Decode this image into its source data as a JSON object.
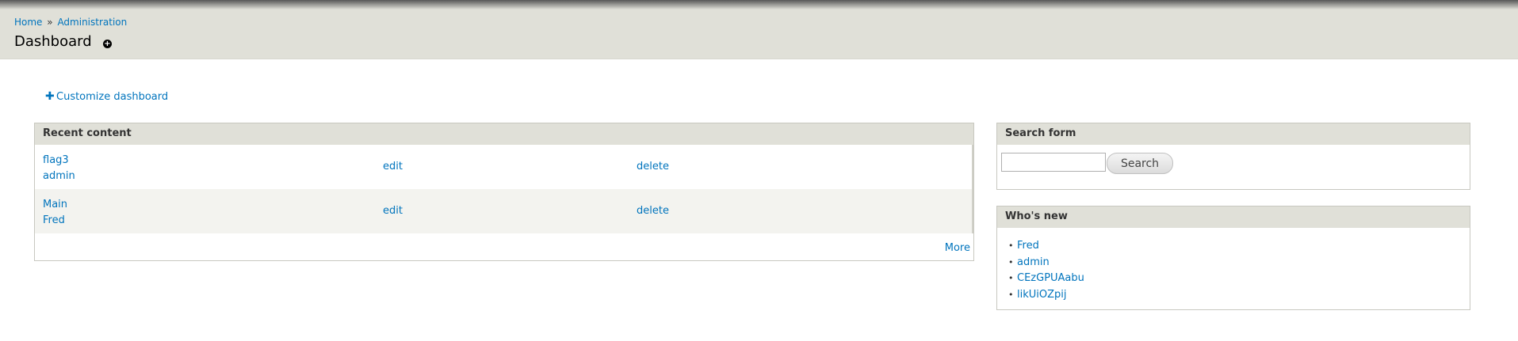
{
  "breadcrumb": {
    "items": [
      {
        "label": "Home"
      },
      {
        "label": "Administration"
      }
    ],
    "separator": "»"
  },
  "page": {
    "title": "Dashboard",
    "shortcut_icon": "add-shortcut-icon"
  },
  "customize": {
    "icon": "plus-icon",
    "label": "Customize dashboard"
  },
  "recent_content": {
    "title": "Recent content",
    "rows": [
      {
        "title": "flag3",
        "author": "admin",
        "edit": "edit",
        "delete": "delete"
      },
      {
        "title": "Main",
        "author": "Fred",
        "edit": "edit",
        "delete": "delete"
      }
    ],
    "more_label": "More"
  },
  "search_form": {
    "title": "Search form",
    "input_value": "",
    "button_label": "Search"
  },
  "whos_new": {
    "title": "Who's new",
    "users": [
      "Fred",
      "admin",
      "CEzGPUAabu",
      "likUiOZpij"
    ]
  },
  "colors": {
    "link": "#0074bd",
    "header_bg": "#e0e0d8",
    "even_row_bg": "#f3f3ef"
  }
}
